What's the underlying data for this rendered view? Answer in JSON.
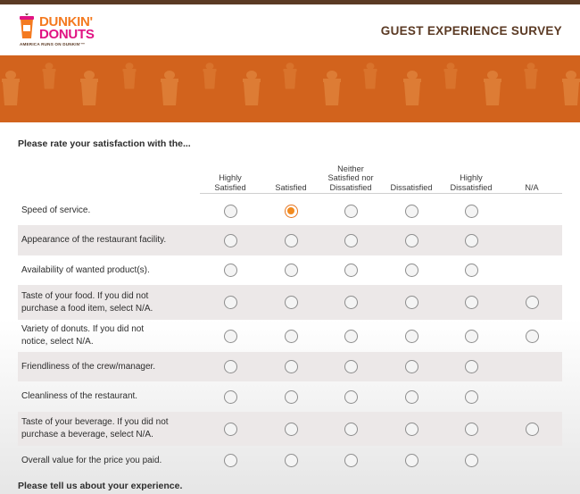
{
  "header": {
    "logo_line1": "DUNKIN'",
    "logo_line2": "DONUTS",
    "logo_tagline": "AMERICA RUNS ON DUNKIN'™",
    "title": "GUEST EXPERIENCE SURVEY"
  },
  "colors": {
    "brand_orange": "#f47a20",
    "brand_pink": "#e11383",
    "banner": "#d2631d",
    "brown": "#5b3a24",
    "row_shade": "#ece8e8"
  },
  "survey": {
    "prompt": "Please rate your satisfaction with the...",
    "columns": [
      "Highly\nSatisfied",
      "Satisfied",
      "Neither\nSatisfied nor\nDissatisfied",
      "Dissatisfied",
      "Highly\nDissatisfied",
      "N/A"
    ],
    "rows": [
      {
        "label": "Speed of service.",
        "has_na": false,
        "selected": 1
      },
      {
        "label": "Appearance of the restaurant facility.",
        "has_na": false,
        "selected": null
      },
      {
        "label": "Availability of wanted product(s).",
        "has_na": false,
        "selected": null
      },
      {
        "label": "Taste of your food. If you did not\npurchase a food item, select N/A.",
        "has_na": true,
        "selected": null
      },
      {
        "label": "Variety of donuts. If you did not\nnotice, select N/A.",
        "has_na": true,
        "selected": null
      },
      {
        "label": "Friendliness of the crew/manager.",
        "has_na": false,
        "selected": null
      },
      {
        "label": "Cleanliness of the restaurant.",
        "has_na": false,
        "selected": null
      },
      {
        "label": "Taste of your beverage. If you did not\npurchase a beverage, select N/A.",
        "has_na": true,
        "selected": null
      },
      {
        "label": "Overall value for the price you paid.",
        "has_na": false,
        "selected": null
      }
    ],
    "footer_prompt": "Please tell us about your experience."
  }
}
